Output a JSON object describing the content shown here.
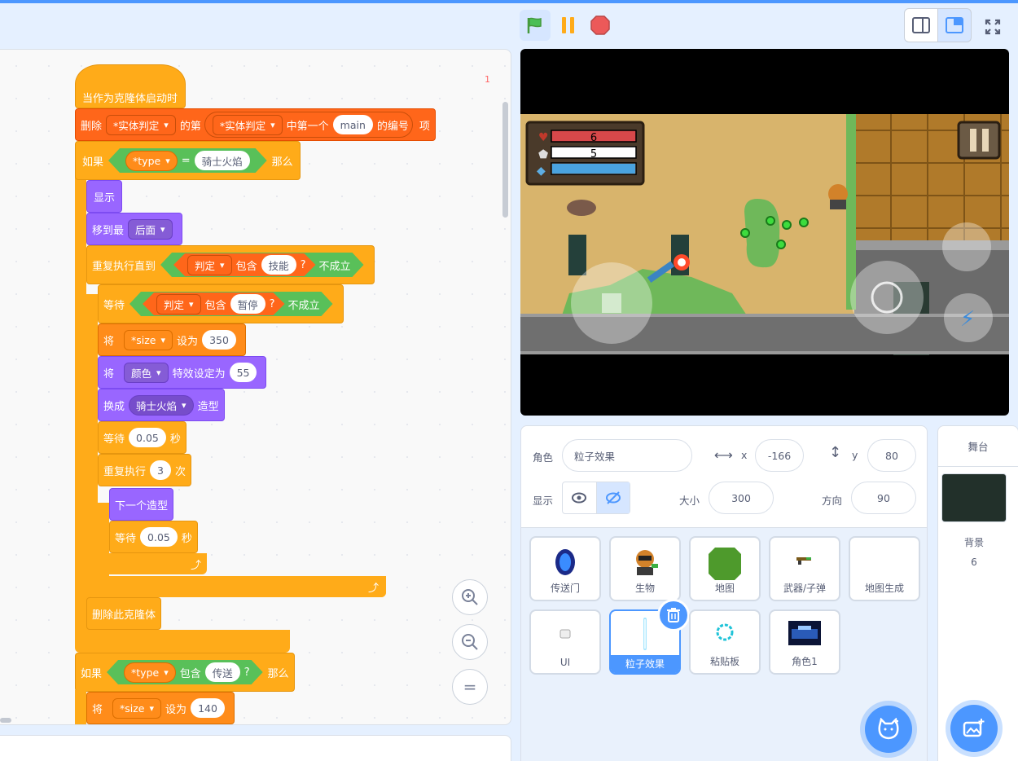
{
  "script": {
    "page_indicator": "1",
    "hat_label": "当作为克隆体启动时",
    "delete_block": {
      "label1": "删除",
      "list1": "*实体判定",
      "label2": "的第",
      "list2": "*实体判定",
      "label3": "中第一个",
      "value": "main",
      "label4": "的编号",
      "label5": "项"
    },
    "if1": {
      "label": "如果",
      "var": "*type",
      "eq": "=",
      "value": "骑士火焰",
      "then": "那么"
    },
    "show": "显示",
    "goto": {
      "label": "移到最",
      "option": "后面"
    },
    "repeat_until": {
      "label": "重复执行直到",
      "list": "判定",
      "contains": "包含",
      "value": "技能",
      "q": "?",
      "not": "不成立"
    },
    "wait_until": {
      "label": "等待",
      "list": "判定",
      "contains": "包含",
      "value": "暂停",
      "q": "?",
      "not": "不成立"
    },
    "set_size": {
      "label": "将",
      "var": "*size",
      "label2": "设为",
      "value": "350"
    },
    "set_effect": {
      "label": "将",
      "effect": "颜色",
      "label2": "特效设定为",
      "value": "55"
    },
    "switch_costume": {
      "label": "换成",
      "costume": "骑士火焰",
      "label2": "造型"
    },
    "wait1": {
      "label": "等待",
      "value": "0.05",
      "unit": "秒"
    },
    "repeat": {
      "label": "重复执行",
      "value": "3",
      "unit": "次"
    },
    "next_costume": "下一个造型",
    "wait2": {
      "label": "等待",
      "value": "0.05",
      "unit": "秒"
    },
    "delete_clone": "删除此克隆体",
    "if2": {
      "label": "如果",
      "var": "*type",
      "contains": "包含",
      "value": "传送",
      "q": "?",
      "then": "那么"
    },
    "set_size2": {
      "label": "将",
      "var": "*size",
      "label2": "设为",
      "value": "140"
    }
  },
  "zoom": {
    "in": "zoom-in",
    "out": "zoom-out",
    "reset": "="
  },
  "game": {
    "hp": "6",
    "shield": "5",
    "energy_fraction": 1.0
  },
  "sprite_info": {
    "sprite_label": "角色",
    "sprite_name": "粒子效果",
    "x_label": "x",
    "x": "-166",
    "y_label": "y",
    "y": "80",
    "show_label": "显示",
    "size_label": "大小",
    "size": "300",
    "direction_label": "方向",
    "direction": "90"
  },
  "sprites": [
    {
      "name": "传送门",
      "icon": "portal-icon"
    },
    {
      "name": "生物",
      "icon": "creature-icon"
    },
    {
      "name": "地图",
      "icon": "map-icon"
    },
    {
      "name": "武器/子弹",
      "icon": "weapon-icon"
    },
    {
      "name": "地图生成",
      "icon": "map-gen-icon"
    },
    {
      "name": "UI",
      "icon": "ui-icon"
    },
    {
      "name": "粒子效果",
      "icon": "particle-icon",
      "selected": true
    },
    {
      "name": "粘贴板",
      "icon": "clipboard-icon"
    },
    {
      "name": "角色1",
      "icon": "role1-icon"
    }
  ],
  "stage_panel": {
    "title": "舞台",
    "backdrop_label": "背景",
    "backdrop_count": "6"
  },
  "colors": {
    "accent": "#4c97ff",
    "events": "#ffab19",
    "lists": "#ff661a",
    "looks": "#9966ff",
    "operators": "#59c059"
  }
}
